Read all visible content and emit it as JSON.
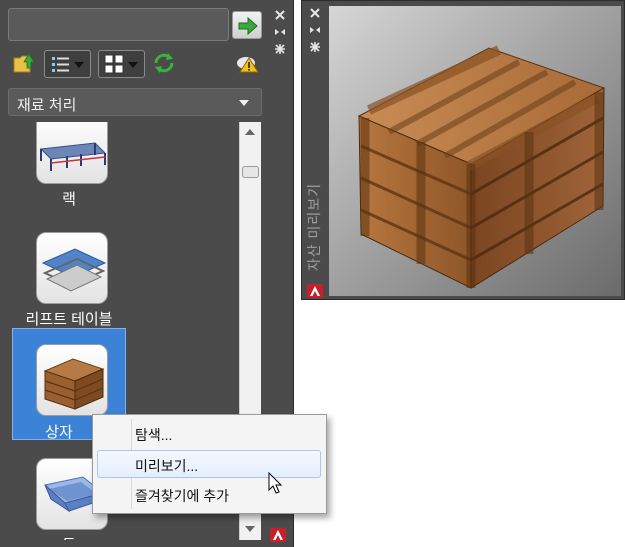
{
  "palette": {
    "search": {
      "value": "",
      "placeholder": ""
    },
    "category": {
      "selected": "재료 처리"
    },
    "items": [
      {
        "label": "랙"
      },
      {
        "label": "리프트 테이블"
      },
      {
        "label": "상자"
      },
      {
        "label": "통"
      }
    ],
    "icons": [
      "go-arrow-icon",
      "close-icon",
      "auto-hide-icon",
      "properties-icon",
      "load-folder-icon",
      "list-view-icon",
      "view-options-icon",
      "refresh-icon",
      "cloud-warning-icon"
    ]
  },
  "context_menu": {
    "items": [
      {
        "label": "탐색..."
      },
      {
        "label": "미리보기..."
      },
      {
        "label": "즐겨찾기에 추가"
      }
    ],
    "highlighted_index": 1
  },
  "preview": {
    "title": "자산 미리보기"
  },
  "colors": {
    "palette_bg": "#4b4b4b",
    "selection": "#3c83d8",
    "accent_red": "#c8202a",
    "go_green": "#3aa83a"
  }
}
